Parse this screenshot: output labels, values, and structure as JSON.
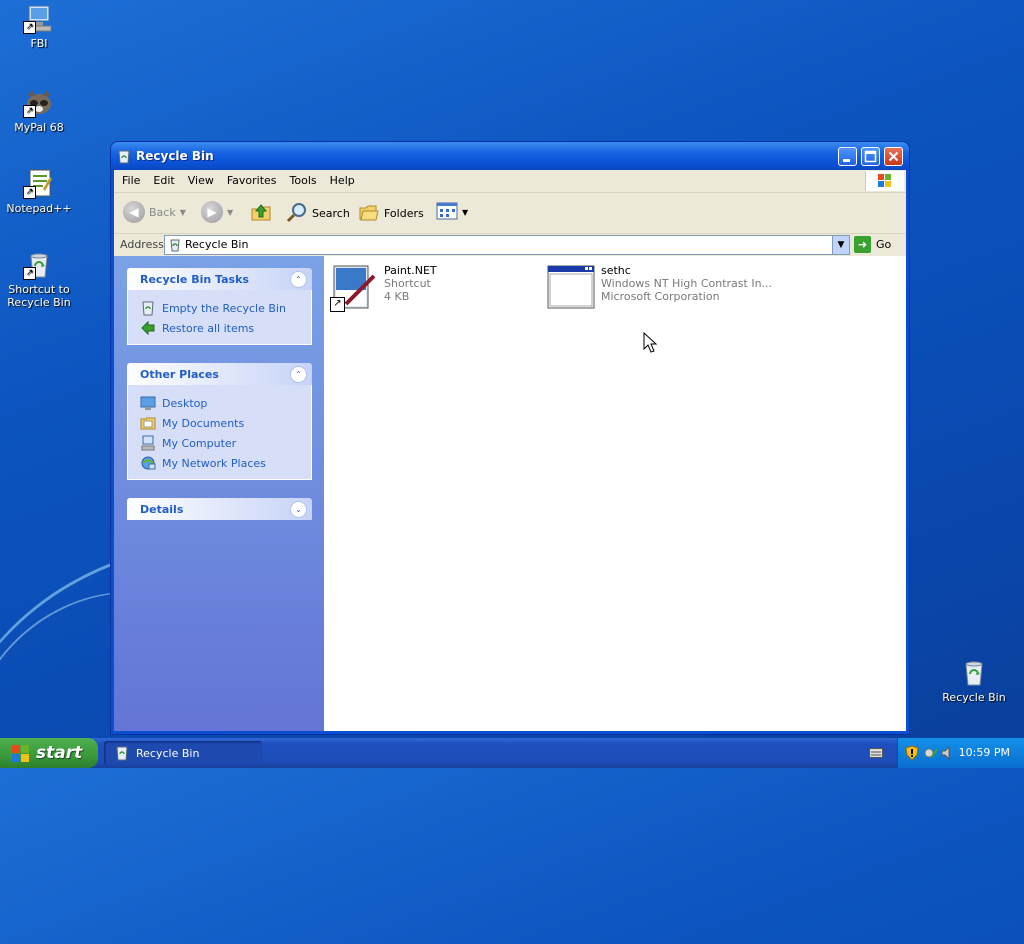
{
  "desktop": {
    "icons": [
      {
        "label": "FBI"
      },
      {
        "label": "MyPal 68"
      },
      {
        "label": "Notepad++"
      },
      {
        "label": "Shortcut to Recycle Bin"
      },
      {
        "label": "Recycle Bin"
      }
    ]
  },
  "window": {
    "title": "Recycle Bin",
    "menu": [
      "File",
      "Edit",
      "View",
      "Favorites",
      "Tools",
      "Help"
    ],
    "toolbar": {
      "back": "Back",
      "search": "Search",
      "folders": "Folders"
    },
    "address": {
      "label": "Address",
      "value": "Recycle Bin",
      "go": "Go"
    },
    "panels": {
      "tasks": {
        "title": "Recycle Bin Tasks",
        "items": [
          "Empty the Recycle Bin",
          "Restore all items"
        ]
      },
      "places": {
        "title": "Other Places",
        "items": [
          "Desktop",
          "My Documents",
          "My Computer",
          "My Network Places"
        ]
      },
      "details": {
        "title": "Details"
      }
    },
    "files": [
      {
        "name": "Paint.NET",
        "line2": "Shortcut",
        "line3": "4 KB"
      },
      {
        "name": "sethc",
        "line2": "Windows NT High Contrast In...",
        "line3": "Microsoft Corporation"
      }
    ]
  },
  "taskbar": {
    "start": "start",
    "item": "Recycle Bin",
    "clock": "10:59 PM"
  },
  "colors": {
    "titlebar": "#0c54d8",
    "taskbar": "#1e4fbf",
    "start": "#3a9a3a",
    "link": "#215dc6"
  }
}
